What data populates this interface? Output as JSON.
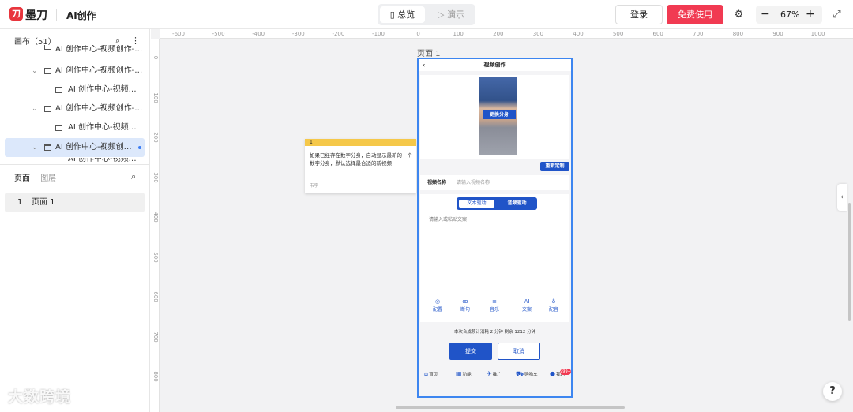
{
  "app": {
    "logo_text": "墨刀",
    "project_title": "AI创作"
  },
  "view_toggle": {
    "overview": "总览",
    "present": "演示"
  },
  "header": {
    "login": "登录",
    "free_trial": "免费使用",
    "zoom": "67%"
  },
  "sidebar": {
    "canvas_header": "画布（51）",
    "tree": [
      {
        "label": "AI 创作中心-视频创作-音乐"
      },
      {
        "label": "AI 创作中心-视频创作-AI..."
      },
      {
        "label": "AI 创作中心-视频创..."
      },
      {
        "label": "AI 创作中心-视频创作-配音"
      },
      {
        "label": "AI 创作中心-视频创..."
      },
      {
        "label": "AI 创作中心-视频创作..."
      },
      {
        "label": "AI 创作中心-视频创..."
      }
    ],
    "tabs": {
      "pages": "页面",
      "layers": "图层"
    },
    "pages": [
      {
        "num": "1",
        "label": "页面 1"
      }
    ]
  },
  "ruler": {
    "h": [
      "-600",
      "-500",
      "-400",
      "-300",
      "-200",
      "-100",
      "0",
      "100",
      "200",
      "300",
      "400",
      "500",
      "600",
      "700",
      "800",
      "900",
      "1000"
    ],
    "v": [
      "0",
      "100",
      "200",
      "300",
      "400",
      "500",
      "600",
      "700",
      "800"
    ]
  },
  "canvas": {
    "page_label": "页面 1"
  },
  "note": {
    "index": "1",
    "text": "如果已经存在数字分身，自动显示最新的一个数字分身，默认选择最合适的新视频",
    "author": "韦宇"
  },
  "phone": {
    "title": "视频创作",
    "swap_avatar": "更换分身",
    "regenerate": "重新定制",
    "name_label": "视频名称",
    "name_placeholder": "请输入视频名称",
    "mode_text": "文本驱动",
    "mode_audio": "音频驱动",
    "text_placeholder": "请输入或粘贴文案",
    "tools": [
      {
        "icon": "◎",
        "label": "配置"
      },
      {
        "icon": "ꝏ",
        "label": "断句"
      },
      {
        "icon": "≡",
        "label": "音乐"
      },
      {
        "icon": "AI",
        "label": "文案"
      },
      {
        "icon": "♁",
        "label": "配音"
      }
    ],
    "cost": "本次合成预计消耗 2 分钟  剩余 1212 分钟",
    "submit": "提交",
    "cancel": "取消",
    "nav": [
      {
        "icon": "⌂",
        "label": "首页"
      },
      {
        "icon": "▦",
        "label": "功能"
      },
      {
        "icon": "✈",
        "label": "推广"
      },
      {
        "icon": "⛟",
        "label": "购物车"
      },
      {
        "icon": "●",
        "label": "我的"
      }
    ],
    "badge": "999+"
  },
  "watermark": "大数跨境",
  "help": "?"
}
